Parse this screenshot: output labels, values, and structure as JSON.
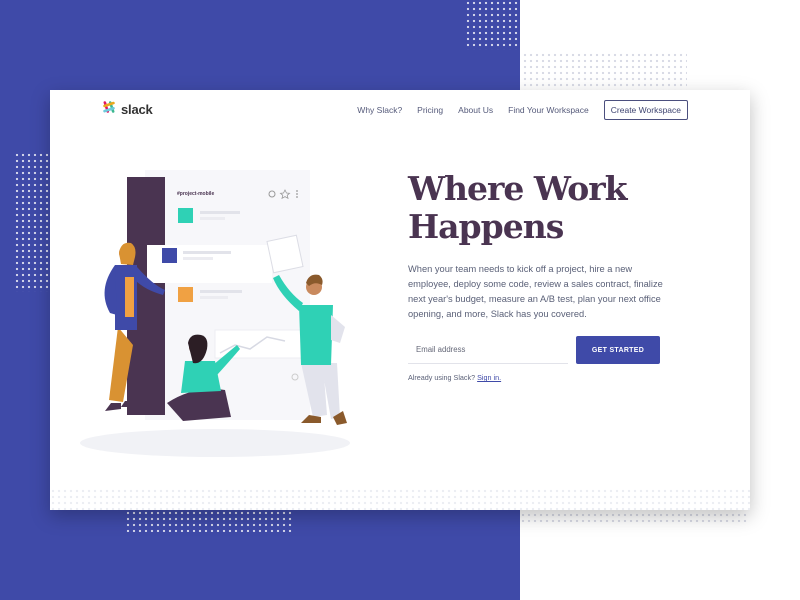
{
  "colors": {
    "page_background_blue": "#3f4aa8",
    "headline": "#4a3451",
    "body_text": "#5b6178",
    "button": "#3f4aa8",
    "aubergine": "#4a3451",
    "teal": "#2fd1b5",
    "orange": "#f0a143"
  },
  "logo": {
    "text": "slack",
    "icon": "slack-hash-icon"
  },
  "nav": {
    "links": [
      "Why Slack?",
      "Pricing",
      "About Us",
      "Find Your Workspace"
    ],
    "cta": "Create Workspace"
  },
  "hero": {
    "headline_line1": "Where Work",
    "headline_line2": "Happens",
    "body": "When your team needs to kick off a project, hire a new employee, deploy some code, review a sales contract, finalize next year's budget, measure an A/B test, plan your next office opening, and more, Slack has you covered.",
    "email_placeholder": "Email address",
    "button_label": "GET STARTED",
    "signin_prefix": "Already using Slack?",
    "signin_link": "Sign in."
  },
  "illustration": {
    "channel_name": "#project-mobile",
    "icons": [
      "settings-icon",
      "star-icon",
      "more-vertical-icon"
    ]
  }
}
